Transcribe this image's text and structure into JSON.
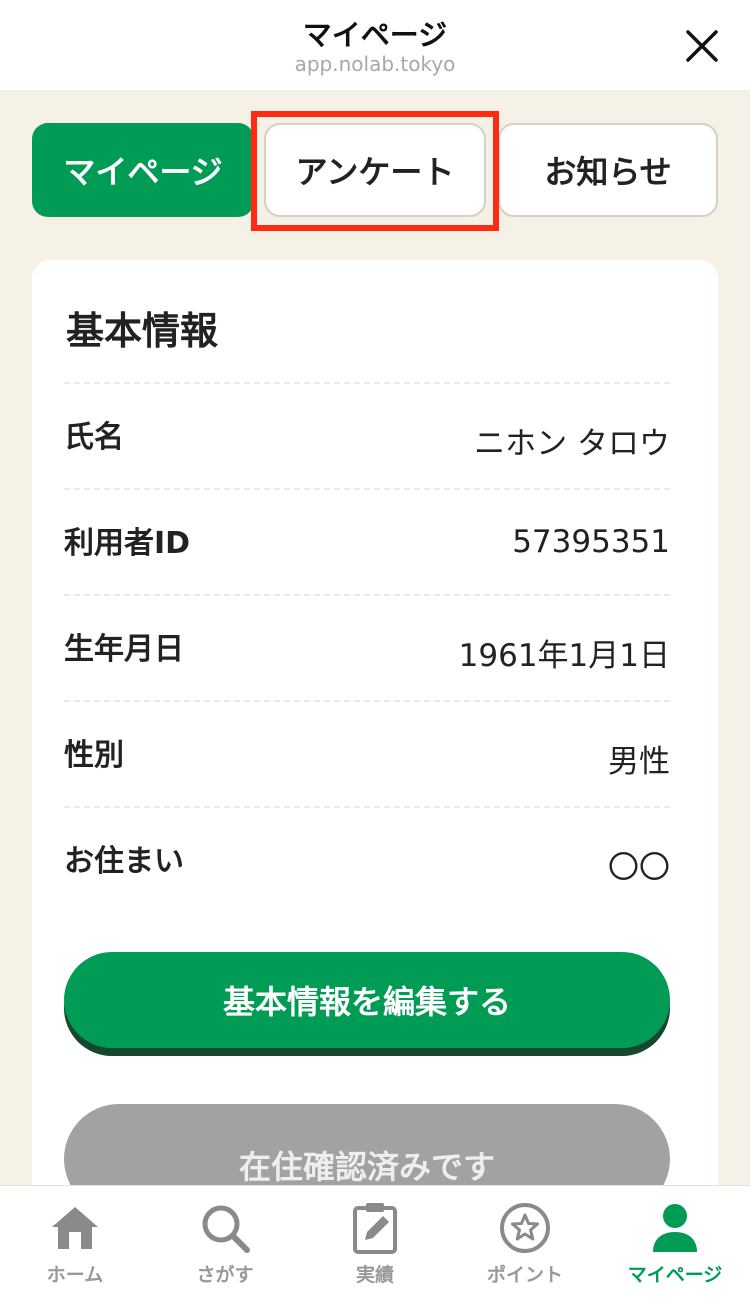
{
  "header": {
    "title": "マイページ",
    "url": "app.nolab.tokyo"
  },
  "tabs": [
    {
      "label": "マイページ",
      "active": true
    },
    {
      "label": "アンケート",
      "active": false,
      "highlighted": true
    },
    {
      "label": "お知らせ",
      "active": false
    }
  ],
  "card": {
    "title": "基本情報",
    "rows": [
      {
        "label": "氏名",
        "value": "ニホン タロウ"
      },
      {
        "label": "利用者ID",
        "value": "57395351"
      },
      {
        "label": "生年月日",
        "value": "1961年1月1日"
      },
      {
        "label": "性別",
        "value": "男性"
      },
      {
        "label": "お住まい",
        "value": "〇〇"
      }
    ],
    "edit_button": "基本情報を編集する",
    "verified_button": "在住確認済みです"
  },
  "bottom_nav": [
    {
      "label": "ホーム",
      "icon": "home-icon"
    },
    {
      "label": "さがす",
      "icon": "search-icon"
    },
    {
      "label": "実績",
      "icon": "clipboard-edit-icon"
    },
    {
      "label": "ポイント",
      "icon": "star-circle-icon"
    },
    {
      "label": "マイページ",
      "icon": "person-icon",
      "active": true
    }
  ],
  "colors": {
    "brand_green": "#009b54",
    "background": "#f5f1e6",
    "highlight_red": "#ff2a12",
    "disabled_gray": "#a2a2a2"
  }
}
